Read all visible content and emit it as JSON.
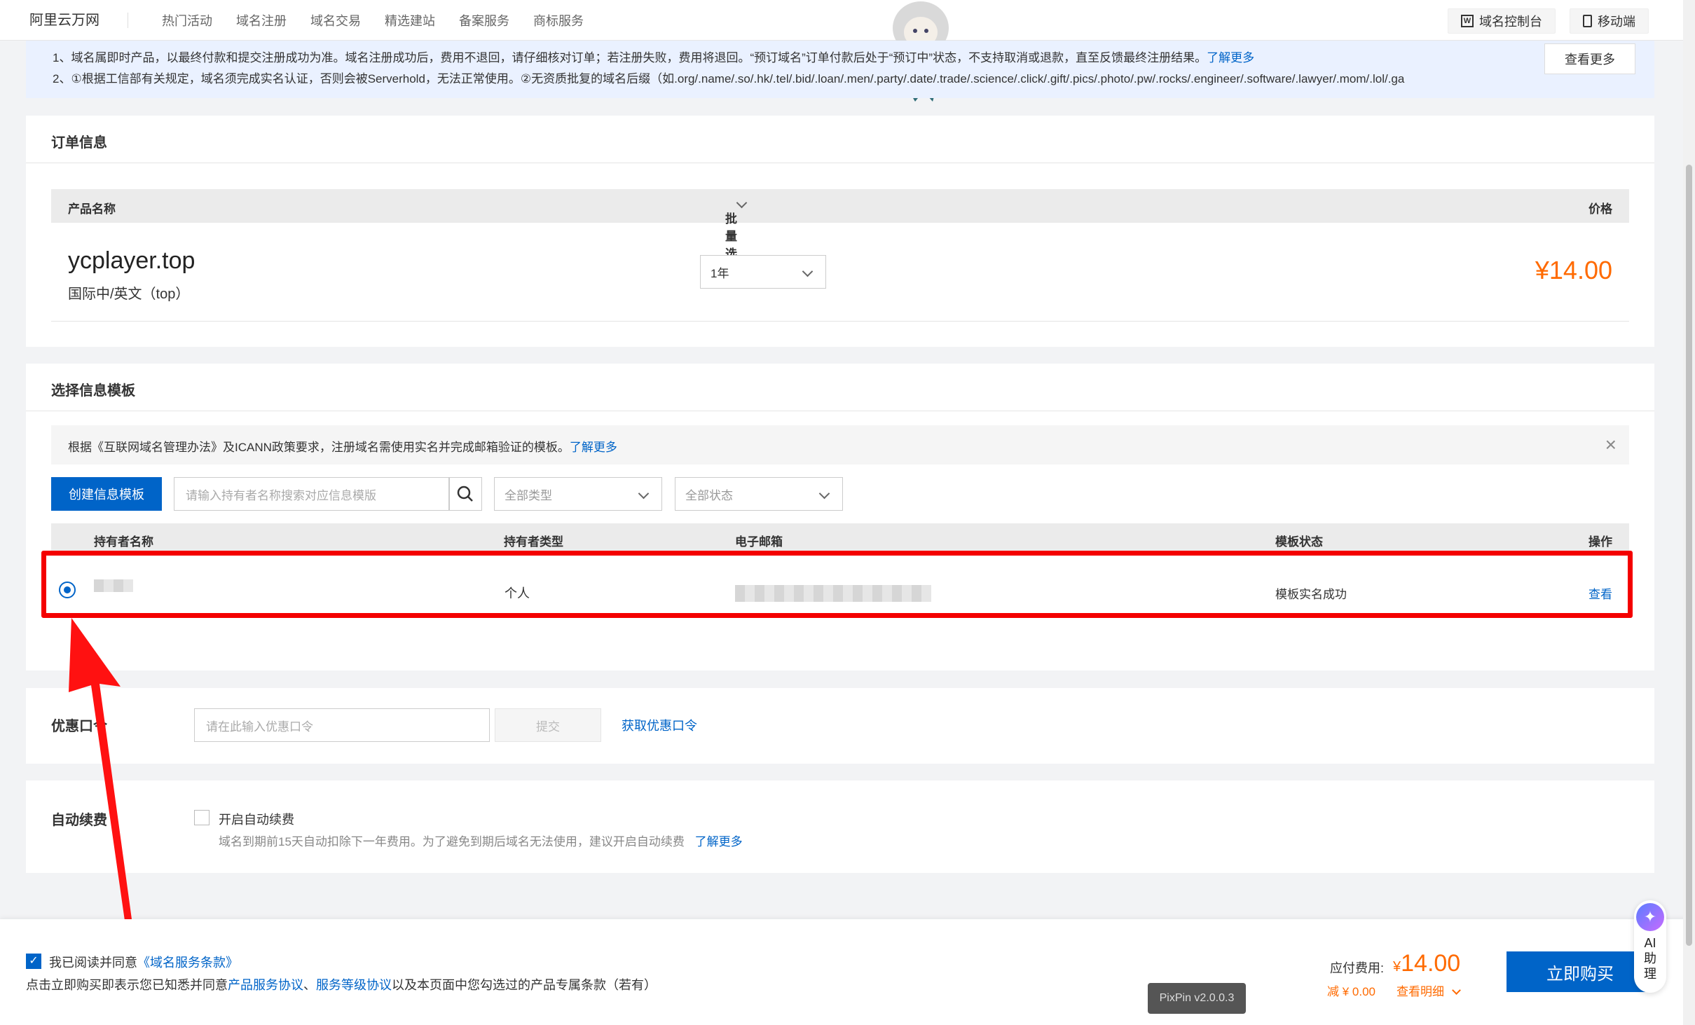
{
  "nav": {
    "brand": "阿里云万网",
    "links": [
      "热门活动",
      "域名注册",
      "域名交易",
      "精选建站",
      "备案服务",
      "商标服务"
    ],
    "console_label": "域名控制台",
    "mobile_label": "移动端"
  },
  "notice": {
    "line1": "1、域名属即时产品，以最终付款和提交注册成功为准。域名注册成功后，费用不退回，请仔细核对订单；若注册失败，费用将退回。“预订域名”订单付款后处于“预订中”状态，不支持取消或退款，直至反馈最终注册结果。",
    "line1_link": "了解更多",
    "line2": "2、①根据工信部有关规定，域名须完成实名认证，否则会被Serverhold，无法正常使用。②无资质批复的域名后缀（如.org/.name/.so/.hk/.tel/.bid/.loan/.men/.party/.date/.trade/.science/.click/.gift/.pics/.photo/.pw/.rocks/.engineer/.software/.lawyer/.mom/.lol/.ga",
    "more_button": "查看更多"
  },
  "order": {
    "title": "订单信息",
    "col_product": "产品名称",
    "col_batch": "批量选择...",
    "col_price": "价格",
    "domain": "ycplayer.top",
    "domain_sub": "国际中/英文（top）",
    "period": "1年",
    "price": "¥14.00"
  },
  "template": {
    "title": "选择信息模板",
    "tip": "根据《互联网域名管理办法》及ICANN政策要求，注册域名需使用实名并完成邮箱验证的模板。",
    "tip_link": "了解更多",
    "create_button": "创建信息模板",
    "search_placeholder": "请输入持有者名称搜索对应信息模版",
    "type_filter": "全部类型",
    "status_filter": "全部状态",
    "columns": [
      "持有者名称",
      "持有者类型",
      "电子邮箱",
      "模板状态",
      "操作"
    ],
    "row": {
      "holder_type": "个人",
      "status": "模板实名成功",
      "action": "查看"
    }
  },
  "coupon": {
    "label": "优惠口令",
    "placeholder": "请在此输入优惠口令",
    "submit": "提交",
    "get_link": "获取优惠口令"
  },
  "renew": {
    "label": "自动续费",
    "option": "开启自动续费",
    "desc": "域名到期前15天自动扣除下一年费用。为了避免到期后域名无法使用，建议开启自动续费",
    "link": "了解更多"
  },
  "footer": {
    "agree_prefix": "我已阅读并同意",
    "agree_link": "《域名服务条款》",
    "notice_prefix": "点击立即购买即表示您已知悉并同意",
    "link1": "产品服务协议",
    "sep": "、",
    "link2": "服务等级协议",
    "notice_suffix": "以及本页面中您勾选过的产品专属条款（若有）",
    "payable_label": "应付费用:",
    "currency": "¥",
    "payable_amount": "14.00",
    "discount": "减 ¥ 0.00",
    "detail_link": "查看明细",
    "buy_button": "立即购买"
  },
  "ai_assistant": "AI助理",
  "pixpin_badge": "PixPin v2.0.0.3",
  "colors": {
    "accent": "#0064c8",
    "price": "#ff6a00",
    "highlight": "#f40000"
  }
}
